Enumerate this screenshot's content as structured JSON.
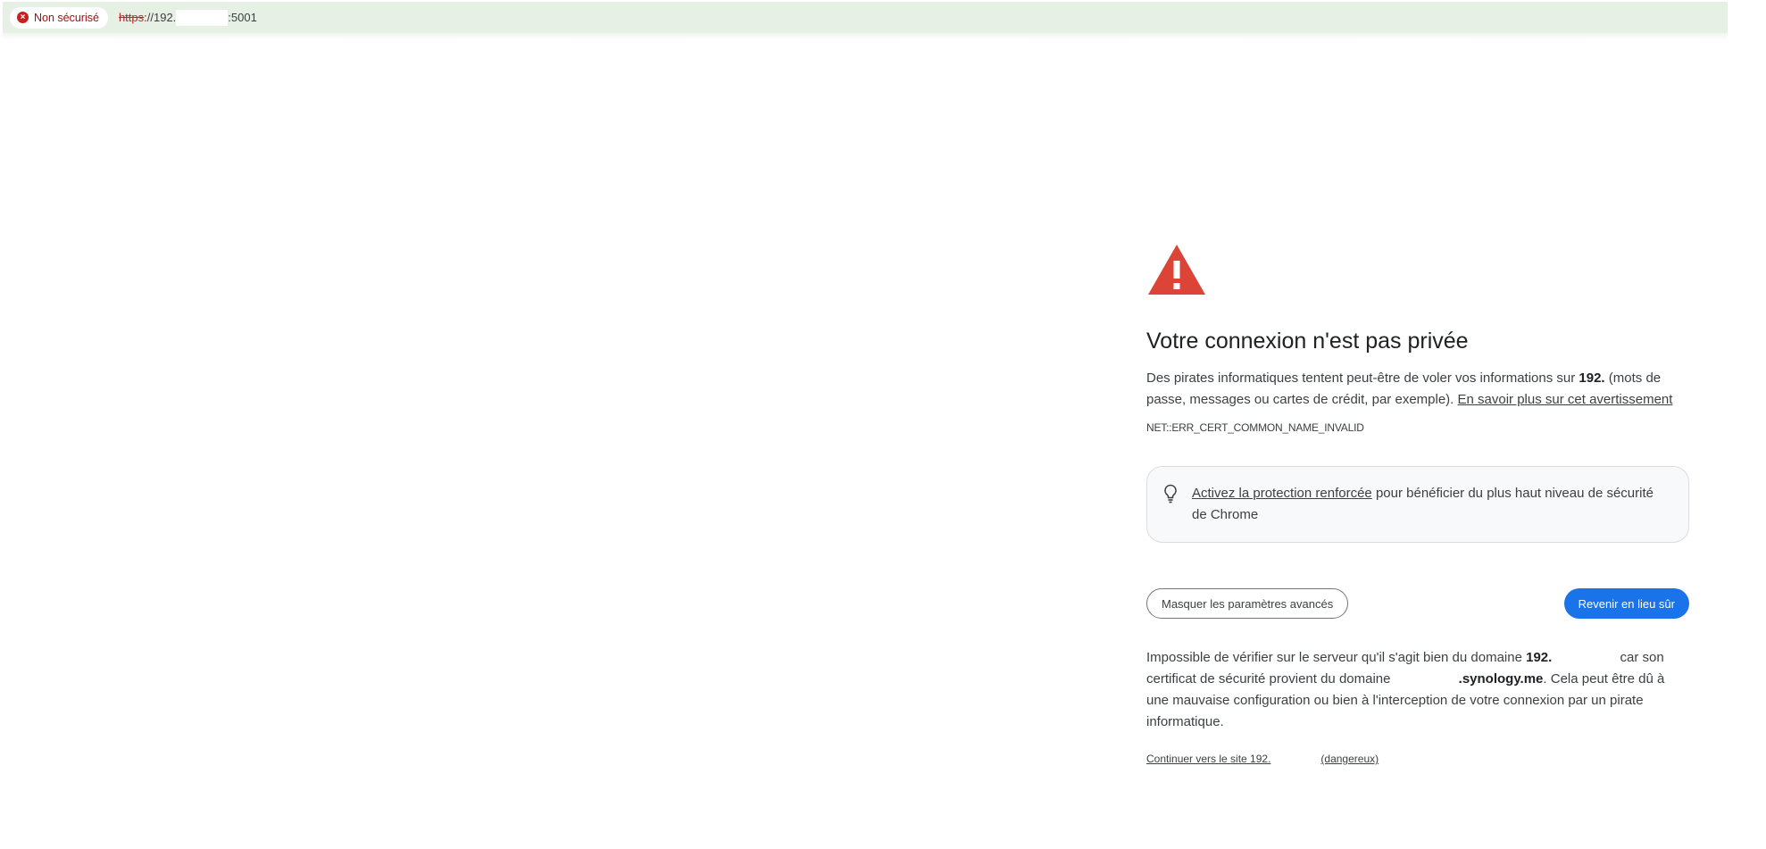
{
  "browser": {
    "security_chip_label": "Non sécurisé",
    "url_scheme": "https",
    "url_sep": "://",
    "url_host_prefix": "192.",
    "url_port": ":5001"
  },
  "interstitial": {
    "title": "Votre connexion n'est pas privée",
    "message_prefix": "Des pirates informatiques tentent peut-être de voler vos informations sur ",
    "message_host": "192.",
    "message_suffix": " (mots de passe, messages ou cartes de crédit, par exemple). ",
    "learn_more_link": "En savoir plus sur cet avertissement",
    "error_code": "NET::ERR_CERT_COMMON_NAME_INVALID",
    "enhanced_protection_link": "Activez la protection renforcée",
    "enhanced_protection_text": " pour bénéficier du plus haut niveau de sécurité de Chrome",
    "advanced_button_label": "Masquer les paramètres avancés",
    "back_button_label": "Revenir en lieu sûr",
    "details_prefix": "Impossible de vérifier sur le serveur qu'il s'agit bien du domaine ",
    "details_host": "192.",
    "details_mid": " car son certificat de sécurité provient du domaine ",
    "details_cert_domain": ".synology.me",
    "details_suffix": ". Cela peut être dû à une mauvaise configuration ou bien à l'interception de votre connexion par un pirate informatique.",
    "proceed_prefix": "Continuer vers le site 192.",
    "proceed_suffix": "(dangereux)"
  },
  "colors": {
    "address_bar_bg": "#e6f0e4",
    "danger_red": "#c5221f",
    "primary_blue": "#1a73e8",
    "warning_triangle": "#db4437"
  }
}
